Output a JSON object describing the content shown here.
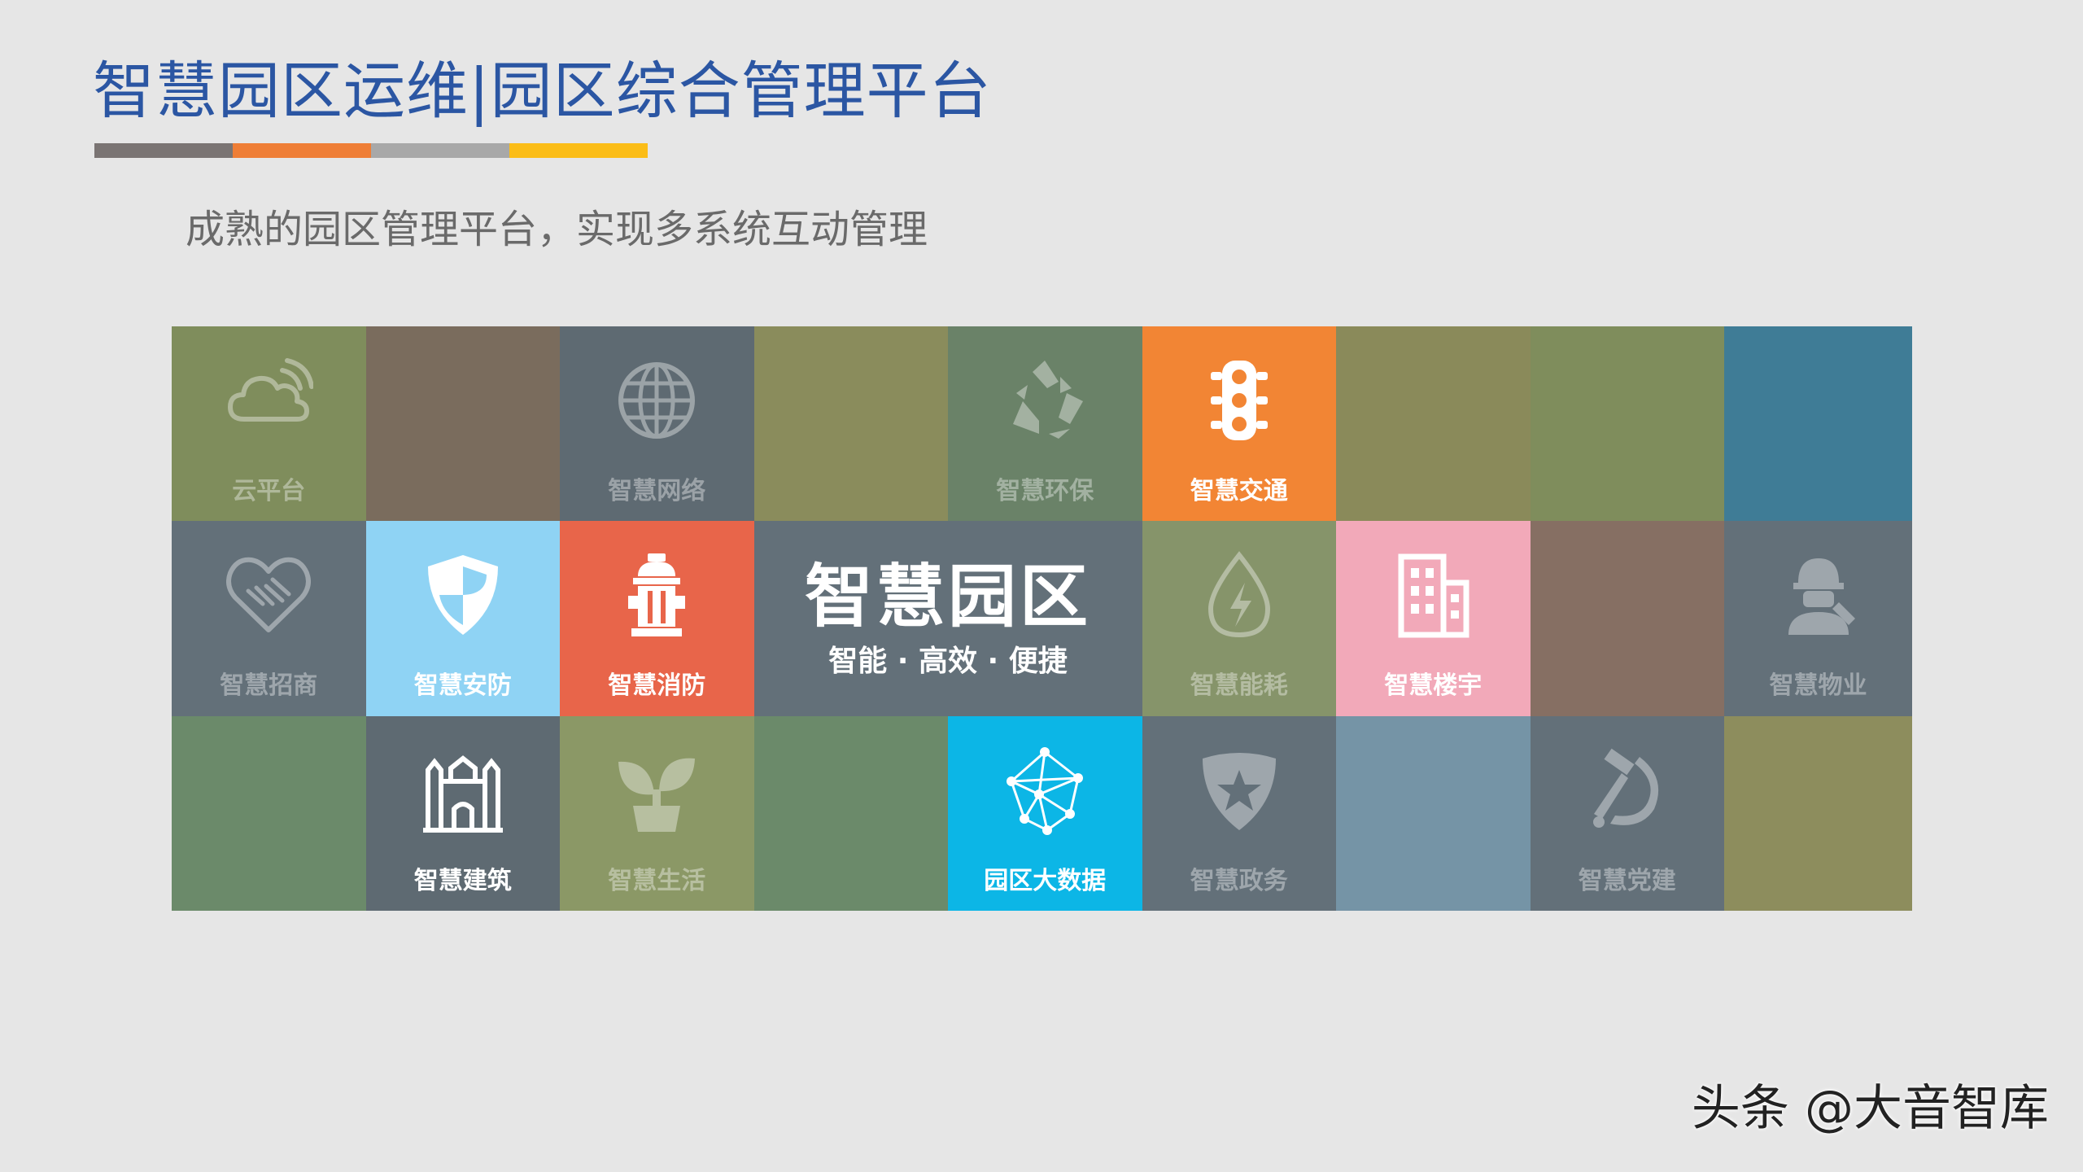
{
  "slide": {
    "title": "智慧园区运维|园区综合管理平台",
    "subtitle": "成熟的园区管理平台，实现多系统互动管理",
    "title_bar_colors": [
      "#7a7473",
      "#ef7e36",
      "#a8a8a8",
      "#fbbd17"
    ]
  },
  "center": {
    "title": "智慧园区",
    "tagline": "智能 · 高效 · 便捷",
    "color": "#637079"
  },
  "tiles": [
    {
      "label": "云平台",
      "icon": "cloud-icon",
      "color": "#7f8d5c",
      "bright": false
    },
    {
      "label": "",
      "icon": "",
      "color": "#7a6c5d",
      "bright": false
    },
    {
      "label": "智慧网络",
      "icon": "globe-icon",
      "color": "#5e6a72",
      "bright": false
    },
    {
      "label": "",
      "icon": "",
      "color": "#8a8c5c",
      "bright": false
    },
    {
      "label": "智慧环保",
      "icon": "recycle-icon",
      "color": "#6a8268",
      "bright": false
    },
    {
      "label": "智慧交通",
      "icon": "traffic-light-icon",
      "color": "#f28534",
      "bright": true
    },
    {
      "label": "",
      "icon": "",
      "color": "#8a8a5a",
      "bright": false
    },
    {
      "label": "",
      "icon": "",
      "color": "#7f8d5c",
      "bright": false
    },
    {
      "label": "",
      "icon": "",
      "color": "#3f7c96",
      "bright": false
    },
    {
      "label": "智慧招商",
      "icon": "handshake-heart-icon",
      "color": "#637079",
      "bright": false
    },
    {
      "label": "智慧安防",
      "icon": "shield-icon",
      "color": "#8fd3f4",
      "bright": true
    },
    {
      "label": "智慧消防",
      "icon": "fire-hydrant-icon",
      "color": "#e8654a",
      "bright": true
    },
    {
      "label": "智慧能耗",
      "icon": "energy-drop-icon",
      "color": "#86946a",
      "bright": false
    },
    {
      "label": "智慧楼宇",
      "icon": "building-icon",
      "color": "#f2a9b9",
      "bright": true
    },
    {
      "label": "",
      "icon": "",
      "color": "#866f63",
      "bright": false
    },
    {
      "label": "智慧物业",
      "icon": "worker-icon",
      "color": "#637079",
      "bright": false
    },
    {
      "label": "",
      "icon": "",
      "color": "#6b8a6a",
      "bright": false
    },
    {
      "label": "智慧建筑",
      "icon": "castle-icon",
      "color": "#5e6a72",
      "bright": true
    },
    {
      "label": "智慧生活",
      "icon": "sprout-icon",
      "color": "#8b9866",
      "bright": false
    },
    {
      "label": "",
      "icon": "",
      "color": "#6b8a6a",
      "bright": false
    },
    {
      "label": "园区大数据",
      "icon": "network-icon",
      "color": "#0cb6e6",
      "bright": true
    },
    {
      "label": "智慧政务",
      "icon": "police-badge-icon",
      "color": "#637079",
      "bright": false
    },
    {
      "label": "",
      "icon": "",
      "color": "#7594a6",
      "bright": false
    },
    {
      "label": "智慧党建",
      "icon": "hammer-sickle-icon",
      "color": "#637079",
      "bright": false
    },
    {
      "label": "",
      "icon": "",
      "color": "#8d8d5d",
      "bright": false
    }
  ],
  "watermark": "头条 @大音智库"
}
